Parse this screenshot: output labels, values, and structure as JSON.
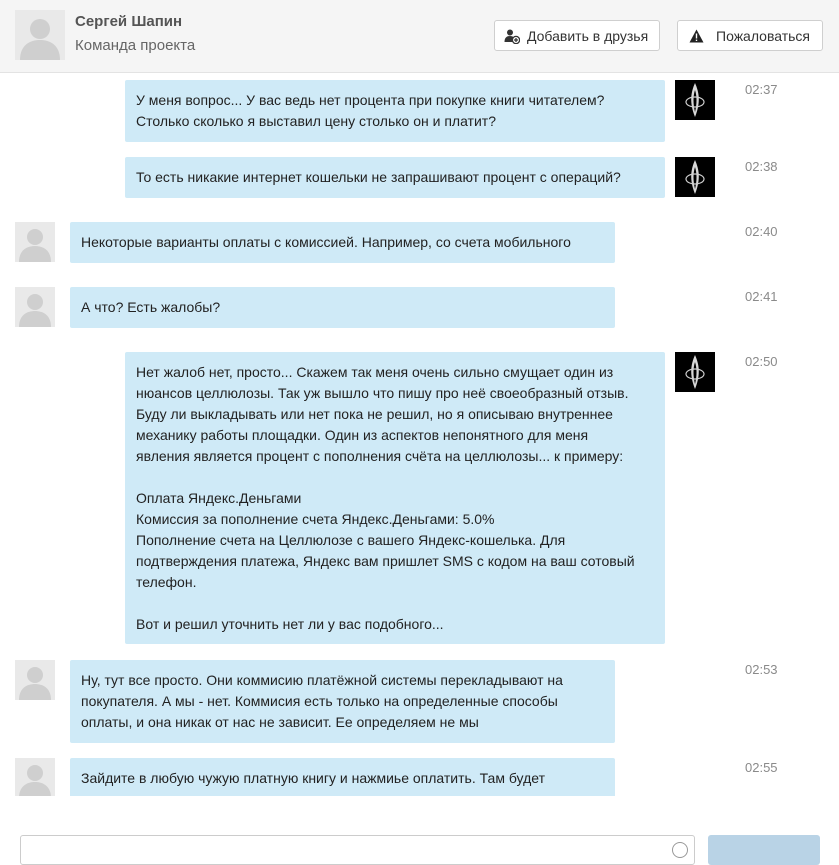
{
  "header": {
    "name": "Сергей Шапин",
    "subtitle": "Команда проекта",
    "add_friend_label": "Добавить в друзья",
    "report_label": "Пожаловаться"
  },
  "messages": [
    {
      "from": "me",
      "time": "02:37",
      "text": "У меня вопрос... У вас ведь нет процента при покупке книги читателем?\nСтолько сколько я выставил цену столько он и платит?"
    },
    {
      "from": "me",
      "time": "02:38",
      "text": "То есть никакие интернет кошельки не запрашивают процент с операций?"
    },
    {
      "from": "them",
      "time": "02:40",
      "text": "Некоторые варианты оплаты с комиссией. Например, со счета мобильного"
    },
    {
      "from": "them",
      "time": "02:41",
      "text": "А что? Есть жалобы?"
    },
    {
      "from": "me",
      "time": "02:50",
      "text": "Нет жалоб нет, просто... Скажем так меня очень сильно смущает один из\nнюансов целлюлозы. Так уж вышло что пишу про неё своеобразный отзыв.\nБуду ли выкладывать или нет пока не решил, но я описываю внутреннее\nмеханику работы площадки. Один из аспектов непонятного для меня\nявления является процент с пополнения счёта на целлюлозы... к примеру:\n\nОплата Яндекс.Деньгами\nКомиссия за пополнение счета Яндекс.Деньгами: 5.0%\nПополнение счета на Целлюлозе с вашего Яндекс-кошелька. Для\nподтверждения платежа, Яндекс вам пришлет SMS с кодом на ваш сотовый\nтелефон.\n\nВот и решил уточнить нет ли у вас подобного..."
    },
    {
      "from": "them",
      "time": "02:53",
      "text": "Ну, тут все просто. Они коммисию платёжной системы перекладывают на\nпокупателя. А мы - нет. Коммисия есть только на определенные способы\nоплаты, и она никак от нас не зависит. Ее определяем не мы"
    },
    {
      "from": "them",
      "time": "02:55",
      "text": "Зайдите в любую чужую платную книгу и нажмиье оплатить. Там будет"
    }
  ],
  "icons": {
    "add_friend": "user-plus-icon",
    "report": "warning-icon"
  },
  "colors": {
    "bubble": "#cfeaf7",
    "header_bg": "#f5f5f5",
    "send_button": "#b9d3e6"
  }
}
